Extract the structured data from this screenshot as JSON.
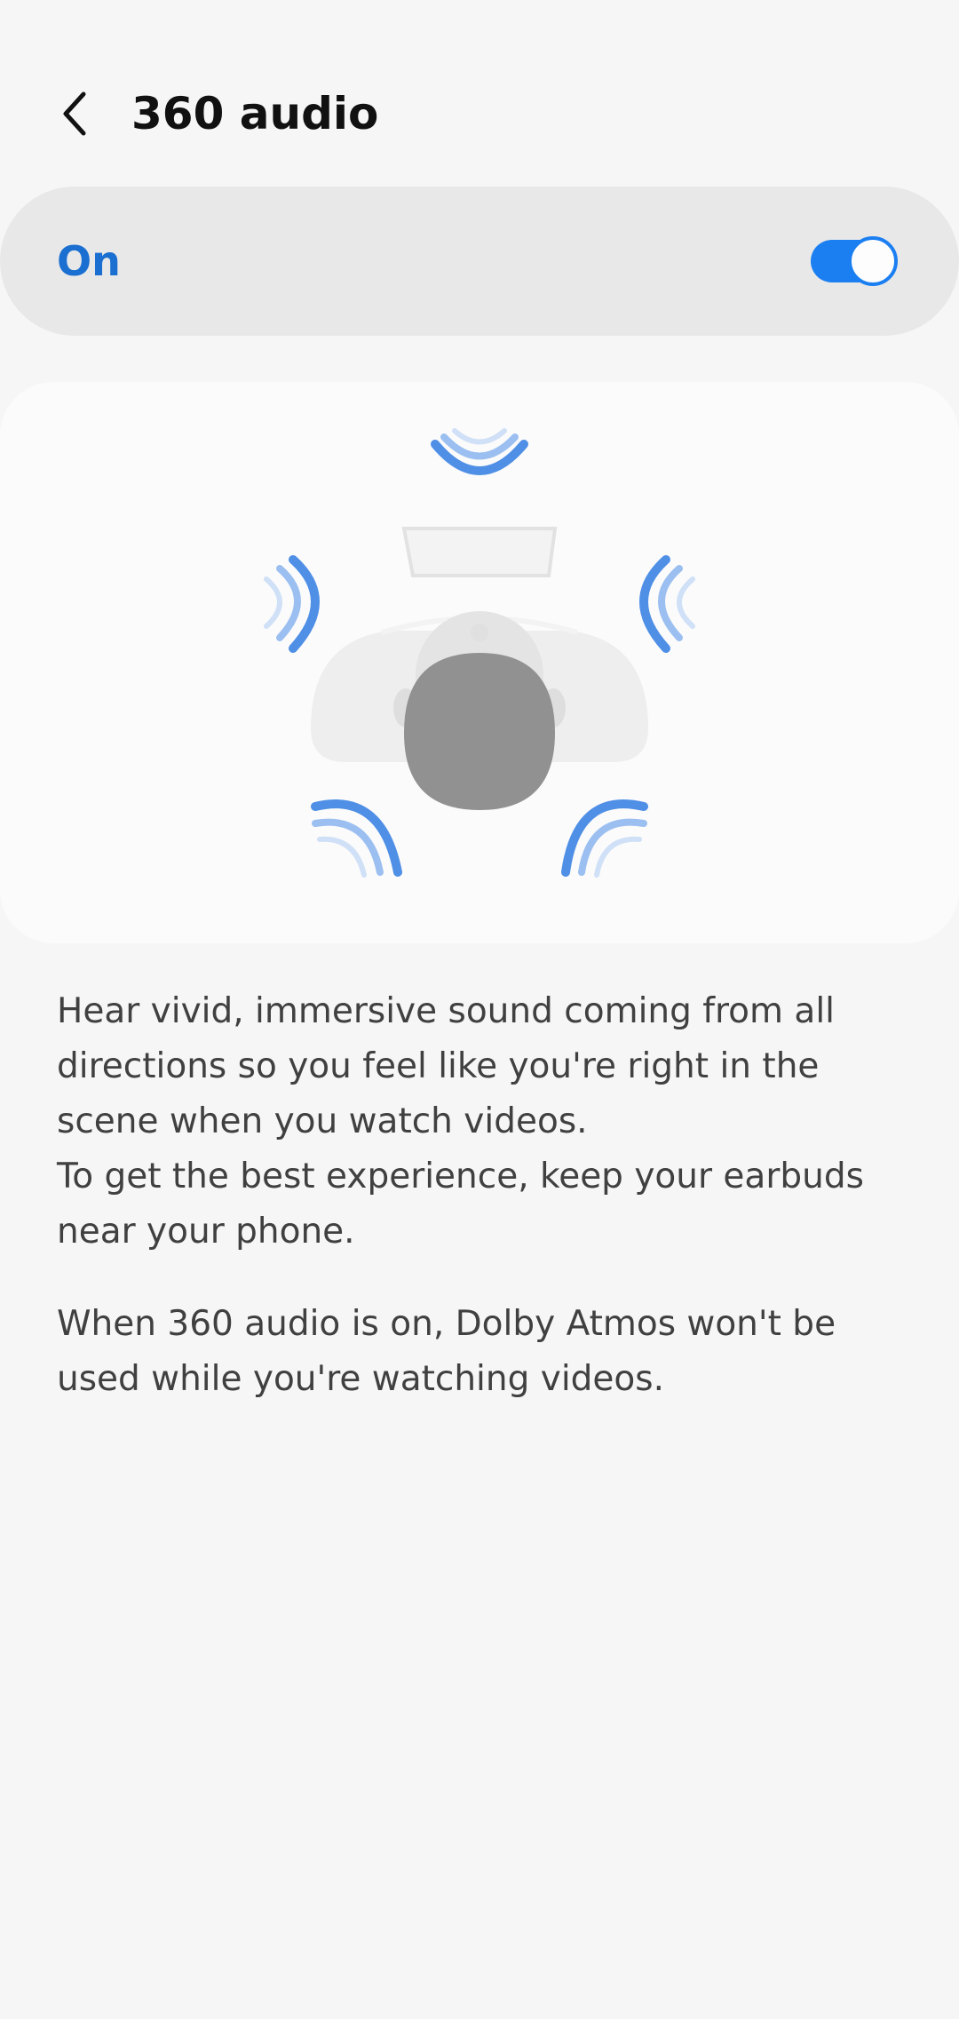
{
  "header": {
    "title": "360 audio",
    "back_icon": "chevron-left-icon"
  },
  "toggle": {
    "label": "On",
    "checked": true,
    "accent_color": "#1b7ff2",
    "label_color": "#1a6fd1"
  },
  "illustration": {
    "description_icon": "spatial-audio-head-icon",
    "wave_colors": [
      "#4f8fe6",
      "#9bbff0",
      "#cfe0f7"
    ]
  },
  "description": {
    "paragraph1_line1": "Hear vivid, immersive sound coming from all directions so you feel like you're right in the scene when you watch videos.",
    "paragraph1_line2": "To get the best experience, keep your earbuds near your phone.",
    "paragraph2": "When 360 audio is on, Dolby Atmos won't be used while you're watching videos."
  }
}
